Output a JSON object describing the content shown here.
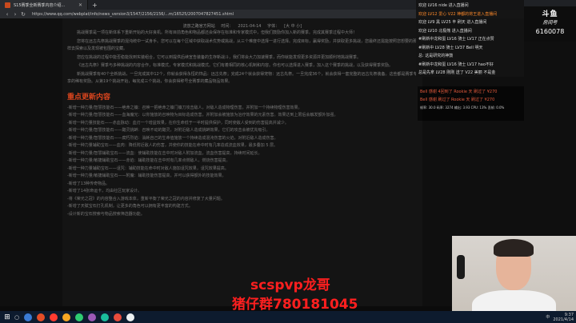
{
  "browser": {
    "tab_title": "S15赛季全新赛季内容介绍...",
    "tab_add": "+",
    "back": "‹",
    "forward": "›",
    "reload": "↻",
    "url": "https://www.qq.com/webplat/info/news_version3/1547/2156/2156/...m/16525/2007047827451.shtml"
  },
  "article": {
    "meta": {
      "source": "流放之路官方网站",
      "time_label": "时间：",
      "time": "2021-04-14",
      "size_label": "字体：",
      "size_options": "[大 中 小]"
    },
    "intro": [
      "挑战赛季是一项在新体系下重新开始的大好良机。所有目前角色和物品都还会保存在标准和专家模式中，但我们鼓励你加入新的赛季。完成其赛季过程中大师！",
      "您将在远古先祭挑战赛季的混沌统中一试身手。您可以在每个区域中获取战术优势或挑战，从三个难度中选择一进行选择。完成目标，赢得奖励，并获取更多挑战，您最终还需能按照您想要的那样去探索以及发现被包围的宝藏。",
      "您应在挑战的过程中能否稳能找到实装组合，它可以到提供后续宣告装备的生存新战斗，我们将会大力加速赛季，而你就能发现更多资源并更加顺利地挑战赛季。",
      "《远古先祭》赛季与多种挑战的内容合作，标准模式，专家模式和挑战模式。它们有着相同的核心机制和内容。你也可以选择进入赛季，加入这个赛季的挑战，以及获得赛季奖励。",
      "新挑战赛季有40个全新挑战，一旦完成其中12个，你就会获得永恒的饰品：远古先祭；完成24个就会获得宠物：远古先祭。一旦完成36个，就会获得一套完整的远古先祭装备。这些都是赛季专享的稀有奖励。从第19个挑战开始，每完成三个挑战，你会获得称号全赛季的藏品物品效果。"
    ],
    "section_title": "重点更新内容",
    "updates": [
      "-新增一种力量/智慧技能石——绝命之镰：召唤一把绝命之镰门镰刀攻击敌人，对敌人造成物理伤害，并附加一个持续物理伤害效果。",
      "-新增一种力量/智慧技能石——血海魔光：以你施放的召唤物为目标造成伤害，并附加会被施放为治疗效果的元素伤害。效果达到上限后会触发额外加强。",
      "-新增一种力量技能石——赤血脉动：血刃一个增益效果，在你生命低于一半时提供保护，同时使敌人受到的伤害提高并减少。",
      "-新增一种力量/智慧技能石——黯灵挑衅：召唤不动的黯灵，对附近敌人造成挑衅效果，它们的攻击会被优先吸引。",
      "-新增一种力量/智慧技能石——腐朽烈焰：消耗自己的生命值施放一个持续造成混沌伤害的火焰，对附近敌人造成伤害。",
      "-新增一种力量辅助宝石——血肉：降低附近敌人的伤害，并使你的技能在命中时有几率造成流血效果，最多叠加 5 层。",
      "-新增一种力量/智慧辅助宝石——流血：使辅助技能在击中时对敌人附加流血，流血伤害提高，持续时间延长。",
      "-新增一种力量/敏捷辅助宝石——赤焰：辅助技能在击中时有几率点燃敌人，燃烧伤害提高。",
      "-新增一种力量辅助宝石——诅咒：辅助技能在命中时对敌人施加诅咒效果，诅咒效果提高。",
      "-新增一种力量/敏捷辅助宝石——附魔：辅助技能伤害提高，并可以获得额外的技能效果。",
      "-新增了13种传奇物品。",
      "-新增了14张命运卡，均由社区玩家设计。",
      "-将《荣光之冠》的内容整合入游戏本体，重新平衡了荣光之冠的内容并修复了大量问题。",
      "-新增了天赋宝石打孔机制，让更多的角色可以拥有更丰富的构建方式。",
      "-设计新的宝石搜索与物品搜索筛选器功能。"
    ]
  },
  "chat": [
    {
      "badge": "",
      "text": "欢迎 LV16 nide 进入直播间",
      "highlight": false
    },
    {
      "badge": "",
      "text": "欢迎 LV12 爱心  V22 神都的将王进入直播间",
      "highlight": true
    },
    {
      "badge": "",
      "text": "欢迎 LV9 黑 LV25 丰 刷天 进入直播间",
      "highlight": false
    },
    {
      "badge": "",
      "text": "欢迎 LV10 北极熊 进入直播间",
      "highlight": false
    },
    {
      "badge": "",
      "text": "#刷新中龙和蛋 LV16 骑士 LV17 正在点赞",
      "highlight": false
    },
    {
      "badge": "",
      "text": "#刷新中 LV28 骑士 LV37 Bell 明天",
      "highlight": false
    },
    {
      "badge": "",
      "text": "总: 这是研究的神鼓",
      "highlight": false
    },
    {
      "badge": "",
      "text": "#刷新中龙和蛋 LV16 骑士 LV17 hao不好",
      "highlight": false
    },
    {
      "badge": "",
      "text": "总是先拿 LV28 刚刚 送了 V22 美丽 不是金",
      "highlight": false
    }
  ],
  "room": {
    "logo": "斗鱼",
    "label": "房间号",
    "number": "6160078"
  },
  "overlay": {
    "line1": "Bell 感谢 4回到了 Rookie 天 刷过了 ¥270",
    "line2": "Bell 感谢 刷过了 Rookie 天 刷过了 ¥270",
    "stats": "帧率: 30.0  码率: 3274  输出: 3.93  CPU: 13%  丢帧: 0.0%"
  },
  "stream": {
    "title": "scspvp龙哥",
    "subtitle": "猪仔群780181045"
  },
  "taskbar": {
    "start": "⊞",
    "search": "○",
    "ime": "中",
    "time": "9:37",
    "date": "2021/4/14"
  },
  "colors": {
    "accent": "#d9451e",
    "stream_text": "#ff1f1f",
    "taskbar": "#0d1b2e"
  }
}
